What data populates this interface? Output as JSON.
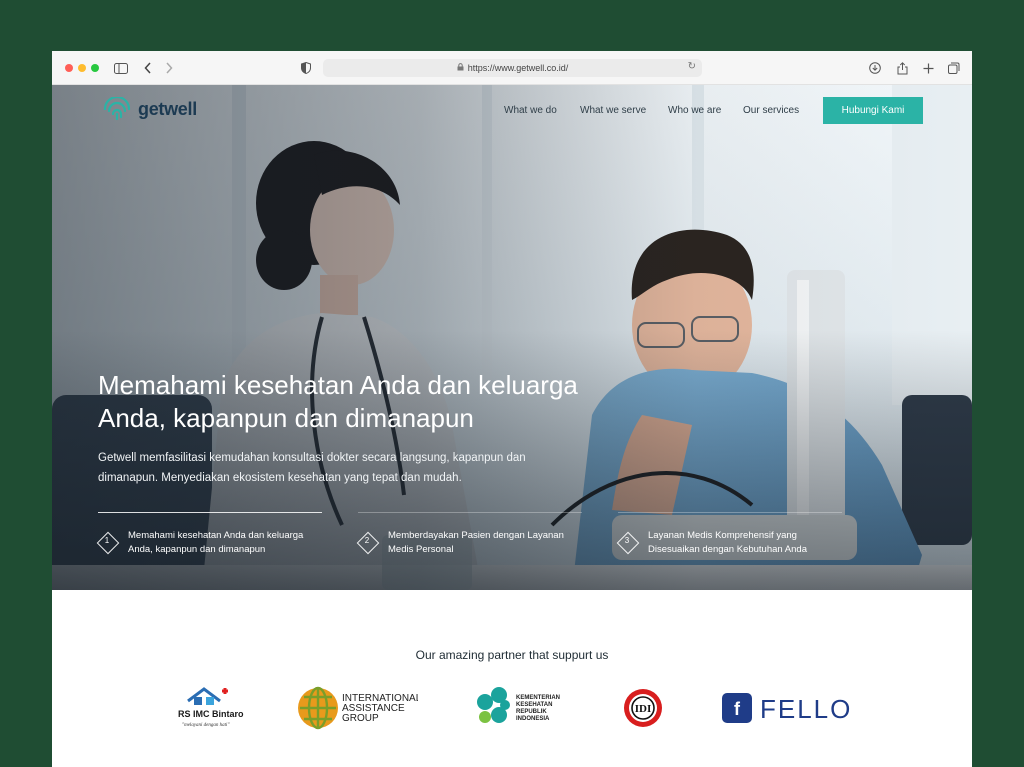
{
  "browser": {
    "url": "https://www.getwell.co.id/"
  },
  "header": {
    "logo_text": "getwell",
    "nav": [
      "What we do",
      "What we serve",
      "Who we are",
      "Our services"
    ],
    "cta_label": "Hubungi Kami"
  },
  "hero": {
    "headline": "Memahami kesehatan Anda dan keluarga Anda, kapanpun dan dimanapun",
    "subtext": "Getwell memfasilitasi kemudahan konsultasi dokter secara langsung, kapanpun dan dimanapun. Menyediakan ekosistem kesehatan yang tepat dan mudah.",
    "features": [
      {
        "num": "1",
        "text": "Memahami kesehatan Anda dan keluarga Anda, kapanpun dan dimanapun"
      },
      {
        "num": "2",
        "text": "Memberdayakan Pasien dengan Layanan Medis Personal"
      },
      {
        "num": "3",
        "text": "Layanan Medis Komprehensif yang Disesuaikan dengan Kebutuhan Anda"
      }
    ]
  },
  "partners": {
    "title": "Our amazing partner that suppurt us",
    "logos": {
      "rs": {
        "name": "RS IMC Bintaro",
        "tagline": "\"melayani dengan hati\""
      },
      "iag": {
        "line1": "INTERNATIONAL",
        "line2": "ASSISTANCE",
        "line3": "GROUP"
      },
      "kemenkes": {
        "line1": "KEMENTERIAN",
        "line2": "KESEHATAN",
        "line3": "REPUBLIK",
        "line4": "INDONESIA"
      },
      "idi": {
        "text": "IDI"
      },
      "fello": {
        "text": "FELLO",
        "icon_letter": "f"
      }
    }
  },
  "colors": {
    "page_bg": "#1f4d33",
    "accent": "#2bb3a6",
    "brand_text": "#1c3a52",
    "fello_blue": "#1f3c88"
  }
}
